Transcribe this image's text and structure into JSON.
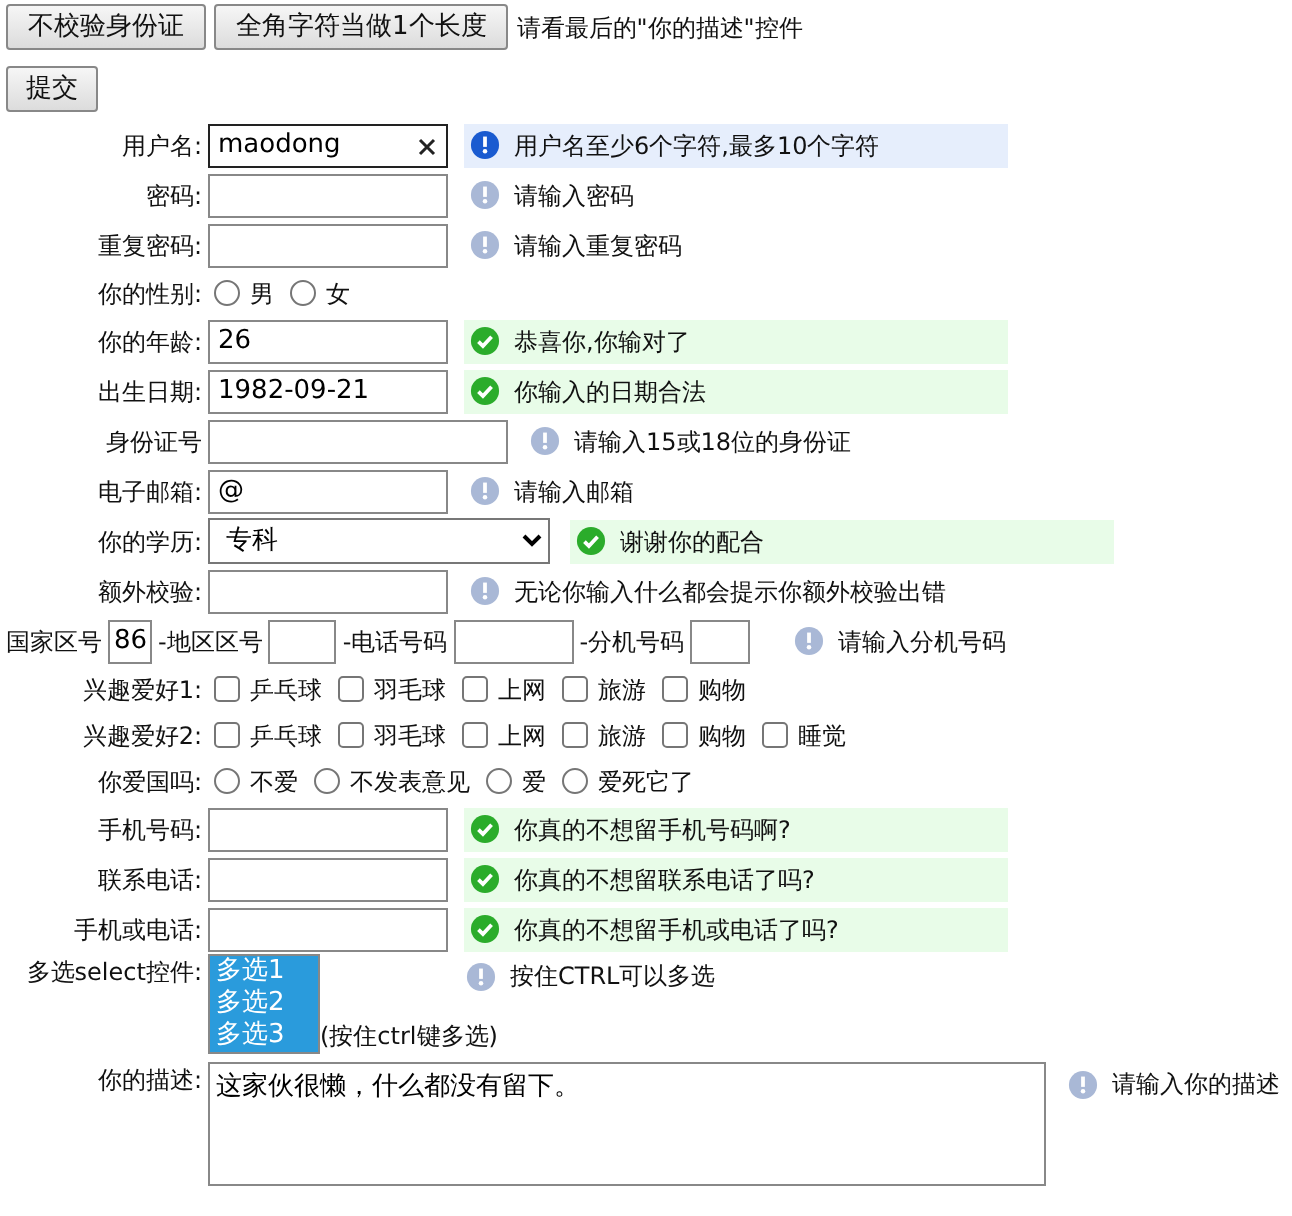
{
  "toolbar": {
    "buttons": [
      "不校验身份证",
      "全角字符当做1个长度"
    ],
    "note": "请看最后的\"你的描述\"控件"
  },
  "submit_button": "提交",
  "rows": [
    {
      "kind": "text",
      "label": "用户名:",
      "value": "maodong",
      "focused": true,
      "tip": {
        "kind": "focus",
        "text": "用户名至少6个字符,最多10个字符"
      }
    },
    {
      "kind": "text",
      "label": "密码:",
      "focused": false,
      "tip": {
        "kind": "hint",
        "text": "请输入密码"
      }
    },
    {
      "kind": "text",
      "label": "重复密码:",
      "focused": false,
      "tip": {
        "kind": "hint",
        "text": "请输入重复密码"
      }
    },
    {
      "kind": "radios",
      "label": "你的性别:",
      "options": [
        {
          "label": "男",
          "checked": false
        },
        {
          "label": "女",
          "checked": false
        }
      ]
    },
    {
      "kind": "text",
      "label": "你的年龄:",
      "value": "26",
      "focused": false,
      "tip": {
        "kind": "ok",
        "text": "恭喜你,你输对了"
      }
    },
    {
      "kind": "text",
      "label": "出生日期:",
      "value": "1982-09-21",
      "focused": false,
      "tip": {
        "kind": "ok",
        "text": "你输入的日期合法"
      }
    },
    {
      "kind": "wide-text",
      "label": "身份证号",
      "focused": false,
      "tip": {
        "kind": "hint",
        "text": "请输入15或18位的身份证"
      }
    },
    {
      "kind": "text",
      "label": "电子邮箱:",
      "value": "@",
      "focused": false,
      "tip": {
        "kind": "hint",
        "text": "请输入邮箱"
      }
    },
    {
      "kind": "select",
      "label": "你的学历:",
      "value": "专科",
      "tip": {
        "kind": "ok",
        "text": "谢谢你的配合"
      }
    },
    {
      "kind": "text",
      "label": "额外校验:",
      "focused": false,
      "tip": {
        "kind": "hint",
        "text": "无论你输入什么都会提示你额外校验出错"
      }
    },
    {
      "kind": "phone",
      "parts": [
        {
          "label": "国家区号",
          "value": "86"
        },
        {
          "label": "-地区区号"
        },
        {
          "label": "-电话号码"
        },
        {
          "label": "-分机号码"
        }
      ],
      "tip": {
        "kind": "hint",
        "text": "请输入分机号码"
      }
    },
    {
      "kind": "checkboxes",
      "label": "兴趣爱好1:",
      "options": [
        {
          "label": "乒乓球",
          "checked": false
        },
        {
          "label": "羽毛球",
          "checked": false
        },
        {
          "label": "上网",
          "checked": false
        },
        {
          "label": "旅游",
          "checked": false
        },
        {
          "label": "购物",
          "checked": false
        }
      ]
    },
    {
      "kind": "checkboxes",
      "label": "兴趣爱好2:",
      "options": [
        {
          "label": "乒乓球",
          "checked": false
        },
        {
          "label": "羽毛球",
          "checked": false
        },
        {
          "label": "上网",
          "checked": false
        },
        {
          "label": "旅游",
          "checked": false
        },
        {
          "label": "购物",
          "checked": false
        },
        {
          "label": "睡觉",
          "checked": false
        }
      ]
    },
    {
      "kind": "radios",
      "label": "你爱国吗:",
      "options": [
        {
          "label": "不爱",
          "checked": false
        },
        {
          "label": "不发表意见",
          "checked": false
        },
        {
          "label": "爱",
          "checked": false
        },
        {
          "label": "爱死它了",
          "checked": false
        }
      ]
    },
    {
      "kind": "text",
      "label": "手机号码:",
      "focused": false,
      "tip": {
        "kind": "ok",
        "text": "你真的不想留手机号码啊?"
      }
    },
    {
      "kind": "text",
      "label": "联系电话:",
      "focused": false,
      "tip": {
        "kind": "ok",
        "text": "你真的不想留联系电话了吗?"
      }
    },
    {
      "kind": "text",
      "label": "手机或电话:",
      "focused": false,
      "tip": {
        "kind": "ok",
        "text": "你真的不想留手机或电话了吗?"
      }
    },
    {
      "kind": "multiselect",
      "label": "多选select控件:",
      "options": [
        {
          "label": "多选1",
          "selected": true
        },
        {
          "label": "多选2",
          "selected": true
        },
        {
          "label": "多选3",
          "selected": true
        }
      ],
      "note": "(按住ctrl键多选)",
      "tip": {
        "kind": "hint",
        "text": "按住CTRL可以多选"
      }
    },
    {
      "kind": "textarea",
      "label": "你的描述:",
      "value": "这家伙很懒，什么都没有留下。",
      "tip": {
        "kind": "hint",
        "text": "请输入你的描述"
      }
    }
  ]
}
